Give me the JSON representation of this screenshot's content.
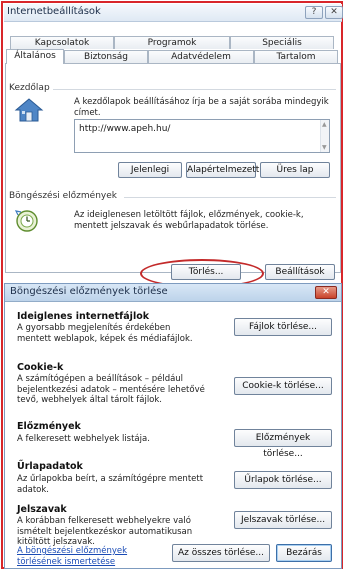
{
  "window": {
    "title": "Internetbeállítások",
    "help_glyph": "?",
    "close_glyph": "✕"
  },
  "tabs": {
    "row1": [
      "Kapcsolatok",
      "Programok",
      "Speciális"
    ],
    "row2": [
      "Általános",
      "Biztonság",
      "Adatvédelem",
      "Tartalom"
    ],
    "active": "Általános"
  },
  "homepage": {
    "group_label": "Kezdőlap",
    "desc": "A kezdőlapok beállításához írja be a saját sorába mindegyik címet.",
    "url": "http://www.apeh.hu/",
    "buttons": [
      "Jelenlegi",
      "Alapértelmezett",
      "Üres lap"
    ]
  },
  "history": {
    "group_label": "Böngészési előzmények",
    "desc": "Az ideiglenesen letöltött fájlok, előzmények, cookie-k, mentett jelszavak és webűrlapadatok törlése.",
    "delete_button": "Törlés...",
    "settings_button": "Beállítások"
  },
  "dialog": {
    "title": "Böngészési előzmények törlése",
    "close_glyph": "✕",
    "sections": [
      {
        "title": "Ideiglenes internetfájlok",
        "desc": "A gyorsabb megjelenítés érdekében mentett weblapok, képek és médiafájlok.",
        "button": "Fájlok törlése..."
      },
      {
        "title": "Cookie-k",
        "desc": "A számítógépen a beállítások – például bejelentkezési adatok – mentésére lehetővé tevő, webhelyek által tárolt fájlok.",
        "button": "Cookie-k törlése..."
      },
      {
        "title": "Előzmények",
        "desc": "A felkeresett webhelyek listája.",
        "button": "Előzmények törlése..."
      },
      {
        "title": "Űrlapadatok",
        "desc": "Az űrlapokba beírt, a számítógépre mentett adatok.",
        "button": "Űrlapok törlése..."
      },
      {
        "title": "Jelszavak",
        "desc": "A korábban felkeresett webhelyekre való ismételt bejelentkezéskor automatikusan kitöltött jelszavak.",
        "button": "Jelszavak törlése..."
      }
    ],
    "help_link": "A böngészési előzmények törlésének ismertetése",
    "delete_all_button": "Az összes törlése...",
    "close_button": "Bezárás"
  },
  "colors": {
    "highlight_ring": "#c32a2a",
    "outer_frame": "#d8262a",
    "link": "#1a4bb5"
  },
  "icons": [
    "home-icon",
    "history-icon"
  ]
}
